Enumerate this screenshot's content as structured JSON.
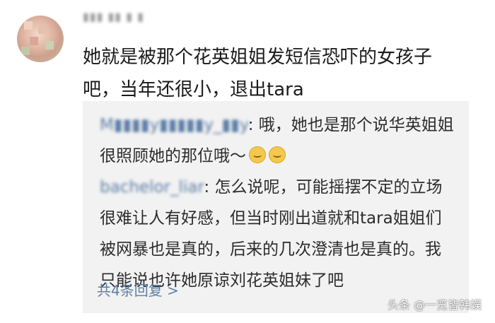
{
  "comment": {
    "username": "▮▮▮ ▮▮ ▮ ▮",
    "text": "她就是被那个花英姐姐发短信恐吓的女孩子吧，当年还很小，退出tara"
  },
  "replies": [
    {
      "username": "M▮▮▮▮y▮▮▮▮▮y_▮▮y",
      "text": "哦，她也是那个说华英姐姐很照顾她的那位哦～",
      "emoji_count": 2
    },
    {
      "username": "bachelor_liar",
      "text": "怎么说呢，可能摇摆不定的立场很难让人有好感，但当时刚出道就和tara姐姐们被网暴也是真的，后来的几次澄清也是真的。我只能说也许她原谅刘花英姐妹了吧"
    }
  ],
  "more_replies": "共4条回复 >",
  "watermark": "头条 @一览皆韩娱"
}
